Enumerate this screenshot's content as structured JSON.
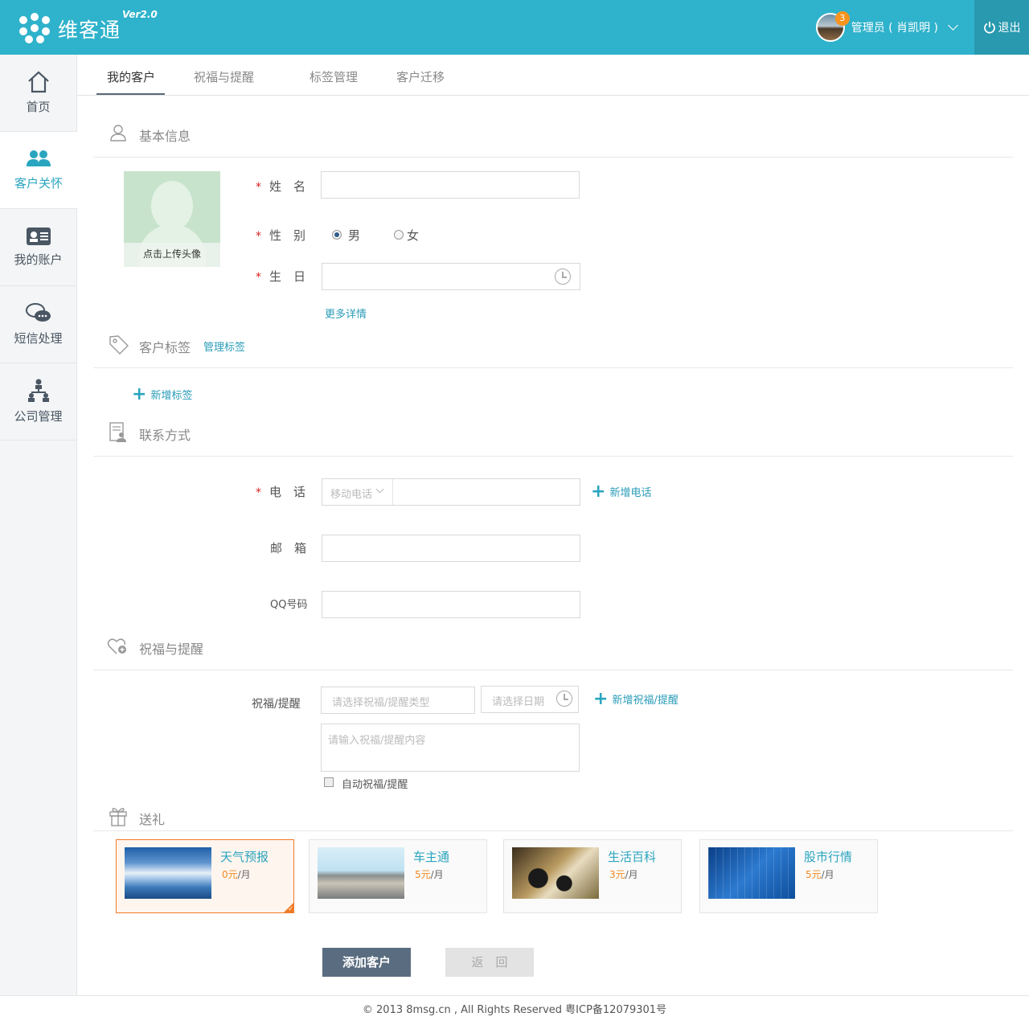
{
  "header": {
    "brand": "维客通",
    "version": "Ver2.0",
    "notification_count": "3",
    "user_name": "管理员 ( 肖凯明 )",
    "logout_label": "退出",
    "brand_color": "#2fb2cb"
  },
  "sidebar": {
    "items": [
      {
        "label": "首页",
        "icon": "home-icon"
      },
      {
        "label": "客户关怀",
        "icon": "customers-icon"
      },
      {
        "label": "我的账户",
        "icon": "account-card-icon"
      },
      {
        "label": "短信处理",
        "icon": "chat-icon"
      },
      {
        "label": "公司管理",
        "icon": "org-chart-icon"
      }
    ],
    "active": "客户关怀"
  },
  "tabs": [
    {
      "label": "我的客户"
    },
    {
      "label": "祝福与提醒"
    },
    {
      "label": "标签管理"
    },
    {
      "label": "客户迁移"
    }
  ],
  "basic": {
    "title": "基本信息",
    "upload_caption": "点击上传头像",
    "name_label": "姓　名",
    "gender_label": "性　别",
    "gender_male": "男",
    "gender_female": "女",
    "birthday_label": "生　日",
    "more_details": "更多详情"
  },
  "tags": {
    "title": "客户标签",
    "manage_link": "管理标签",
    "add_tag": "新增标签"
  },
  "contact": {
    "title": "联系方式",
    "phone_label": "电　话",
    "phone_type": "移动电话",
    "add_phone": "新增电话",
    "email_label": "邮　箱",
    "qq_label": "QQ号码"
  },
  "greeting": {
    "title": "祝福与提醒",
    "label": "祝福/提醒",
    "type_placeholder": "请选择祝福/提醒类型",
    "date_placeholder": "请选择日期",
    "add_greeting": "新增祝福/提醒",
    "content_placeholder": "请输入祝福/提醒内容",
    "auto_label": "自动祝福/提醒"
  },
  "gifts": {
    "title": "送礼",
    "items": [
      {
        "name": "天气预报",
        "price": "0元",
        "unit": "/月",
        "selected": true
      },
      {
        "name": "车主通",
        "price": "5元",
        "unit": "/月",
        "selected": false
      },
      {
        "name": "生活百科",
        "price": "3元",
        "unit": "/月",
        "selected": false
      },
      {
        "name": "股市行情",
        "price": "5元",
        "unit": "/月",
        "selected": false
      }
    ]
  },
  "actions": {
    "submit": "添加客户",
    "back": "返　回"
  },
  "footer": {
    "text": "© 2013 8msg.cn , All Rights Reserved 粤ICP备12079301号"
  }
}
